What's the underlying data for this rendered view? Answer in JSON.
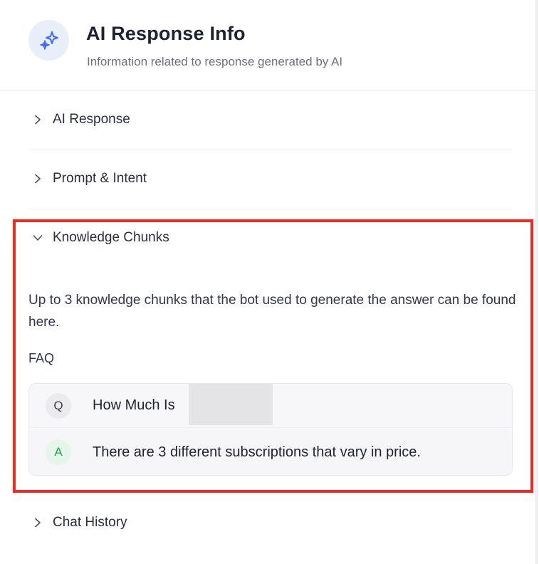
{
  "header": {
    "icon": "sparkles-icon",
    "title": "AI Response Info",
    "subtitle": "Information related to response generated by AI"
  },
  "accordion": {
    "ai_response": {
      "label": "AI Response",
      "expanded": false
    },
    "prompt_intent": {
      "label": "Prompt & Intent",
      "expanded": false
    },
    "knowledge_chunks": {
      "label": "Knowledge Chunks",
      "expanded": true,
      "description": "Up to 3 knowledge chunks that the bot used to generate the answer can be found here.",
      "section_label": "FAQ",
      "faq": {
        "question_badge": "Q",
        "question": "How Much Is",
        "answer_badge": "A",
        "answer": "There are 3 different subscriptions that vary in price."
      }
    },
    "chat_history": {
      "label": "Chat History",
      "expanded": false
    }
  },
  "colors": {
    "highlight_border": "#ee2b23",
    "icon_accent": "#3b6ff5",
    "answer_badge": "#2e9a55"
  }
}
